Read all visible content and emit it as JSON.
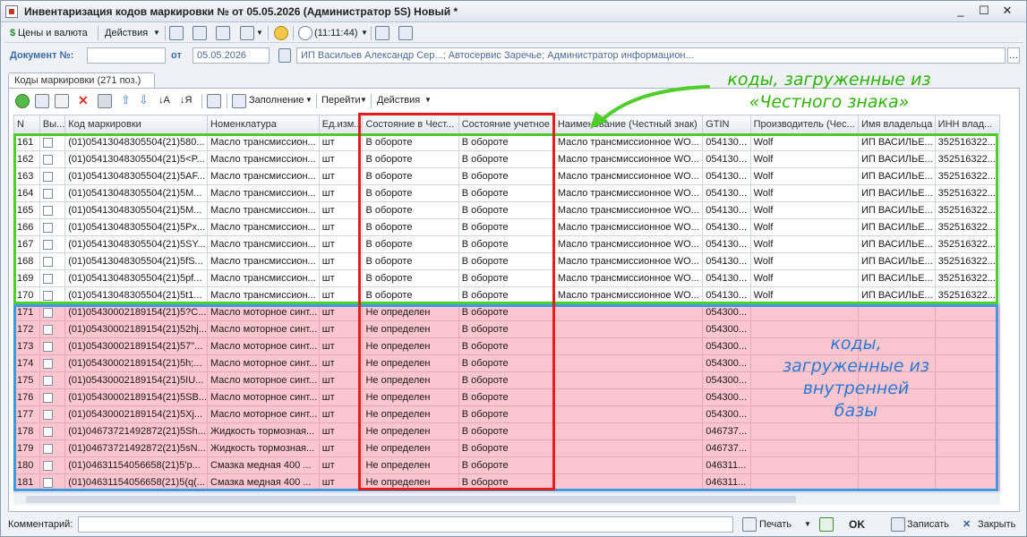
{
  "window": {
    "title": "Инвентаризация кодов маркировки №  от 05.05.2026 (Администратор 5S) Новый *",
    "controls": [
      "_",
      "☐",
      "✕"
    ]
  },
  "toolbar": {
    "prices_label": "Цены и валюта",
    "actions_label": "Действия",
    "time_label": "(11:11:44)"
  },
  "document": {
    "number_label": "Документ №:",
    "number_value": "",
    "date_label": "от",
    "date_value": "05.05.2026",
    "info_value": "ИП Васильев Александр Сер...; Автосервис Заречье; Администратор информацион..."
  },
  "tab": {
    "label": "Коды маркировки (271 поз.)"
  },
  "panel_toolbar": {
    "fill_label": "Заполнение",
    "goto_label": "Перейти",
    "actions_label": "Действия"
  },
  "table": {
    "columns": [
      "N",
      "Вы...",
      "Код маркировки",
      "Номенклатура",
      "Ед.изм...",
      "Состояние в Чест...",
      "Состояние учетное",
      "Наименование (Честный знак)",
      "GTIN",
      "Производитель (Чес...",
      "Имя владельца",
      "ИНН влад..."
    ],
    "rows": [
      {
        "n": "161",
        "code": "(01)05413048305504(21)580...",
        "nom": "Масло трансмиссион...",
        "unit": "шт",
        "state_cz": "В обороте",
        "state_acc": "В обороте",
        "name_cz": "Масло трансмиссионное WO...",
        "gtin": "054130...",
        "maker": "Wolf",
        "owner": "ИП ВАСИЛЬЕ...",
        "inn": "352516322..."
      },
      {
        "n": "162",
        "code": "(01)05413048305504(21)5<P...",
        "nom": "Масло трансмиссион...",
        "unit": "шт",
        "state_cz": "В обороте",
        "state_acc": "В обороте",
        "name_cz": "Масло трансмиссионное WO...",
        "gtin": "054130...",
        "maker": "Wolf",
        "owner": "ИП ВАСИЛЬЕ...",
        "inn": "352516322..."
      },
      {
        "n": "163",
        "code": "(01)05413048305504(21)5AF...",
        "nom": "Масло трансмиссион...",
        "unit": "шт",
        "state_cz": "В обороте",
        "state_acc": "В обороте",
        "name_cz": "Масло трансмиссионное WO...",
        "gtin": "054130...",
        "maker": "Wolf",
        "owner": "ИП ВАСИЛЬЕ...",
        "inn": "352516322..."
      },
      {
        "n": "164",
        "code": "(01)05413048305504(21)5M...",
        "nom": "Масло трансмиссион...",
        "unit": "шт",
        "state_cz": "В обороте",
        "state_acc": "В обороте",
        "name_cz": "Масло трансмиссионное WO...",
        "gtin": "054130...",
        "maker": "Wolf",
        "owner": "ИП ВАСИЛЬЕ...",
        "inn": "352516322..."
      },
      {
        "n": "165",
        "code": "(01)05413048305504(21)5M...",
        "nom": "Масло трансмиссион...",
        "unit": "шт",
        "state_cz": "В обороте",
        "state_acc": "В обороте",
        "name_cz": "Масло трансмиссионное WO...",
        "gtin": "054130...",
        "maker": "Wolf",
        "owner": "ИП ВАСИЛЬЕ...",
        "inn": "352516322..."
      },
      {
        "n": "166",
        "code": "(01)05413048305504(21)5Px...",
        "nom": "Масло трансмиссион...",
        "unit": "шт",
        "state_cz": "В обороте",
        "state_acc": "В обороте",
        "name_cz": "Масло трансмиссионное WO...",
        "gtin": "054130...",
        "maker": "Wolf",
        "owner": "ИП ВАСИЛЬЕ...",
        "inn": "352516322..."
      },
      {
        "n": "167",
        "code": "(01)05413048305504(21)5SY...",
        "nom": "Масло трансмиссион...",
        "unit": "шт",
        "state_cz": "В обороте",
        "state_acc": "В обороте",
        "name_cz": "Масло трансмиссионное WO...",
        "gtin": "054130...",
        "maker": "Wolf",
        "owner": "ИП ВАСИЛЬЕ...",
        "inn": "352516322..."
      },
      {
        "n": "168",
        "code": "(01)05413048305504(21)5fS...",
        "nom": "Масло трансмиссион...",
        "unit": "шт",
        "state_cz": "В обороте",
        "state_acc": "В обороте",
        "name_cz": "Масло трансмиссионное WO...",
        "gtin": "054130...",
        "maker": "Wolf",
        "owner": "ИП ВАСИЛЬЕ...",
        "inn": "352516322..."
      },
      {
        "n": "169",
        "code": "(01)05413048305504(21)5pf...",
        "nom": "Масло трансмиссион...",
        "unit": "шт",
        "state_cz": "В обороте",
        "state_acc": "В обороте",
        "name_cz": "Масло трансмиссионное WO...",
        "gtin": "054130...",
        "maker": "Wolf",
        "owner": "ИП ВАСИЛЬЕ...",
        "inn": "352516322..."
      },
      {
        "n": "170",
        "code": "(01)05413048305504(21)5t1...",
        "nom": "Масло трансмиссион...",
        "unit": "шт",
        "state_cz": "В обороте",
        "state_acc": "В обороте",
        "name_cz": "Масло трансмиссионное WO...",
        "gtin": "054130...",
        "maker": "Wolf",
        "owner": "ИП ВАСИЛЬЕ...",
        "inn": "352516322..."
      },
      {
        "n": "171",
        "code": "(01)05430002189154(21)5?C...",
        "nom": "Масло моторное синт...",
        "unit": "шт",
        "state_cz": "Не определен",
        "state_acc": "В обороте",
        "name_cz": "",
        "gtin": "054300...",
        "maker": "",
        "owner": "",
        "inn": ""
      },
      {
        "n": "172",
        "code": "(01)05430002189154(21)52hj...",
        "nom": "Масло моторное синт...",
        "unit": "шт",
        "state_cz": "Не определен",
        "state_acc": "В обороте",
        "name_cz": "",
        "gtin": "054300...",
        "maker": "",
        "owner": "",
        "inn": ""
      },
      {
        "n": "173",
        "code": "(01)05430002189154(21)57\"...",
        "nom": "Масло моторное синт...",
        "unit": "шт",
        "state_cz": "Не определен",
        "state_acc": "В обороте",
        "name_cz": "",
        "gtin": "054300...",
        "maker": "",
        "owner": "",
        "inn": ""
      },
      {
        "n": "174",
        "code": "(01)05430002189154(21)5h;...",
        "nom": "Масло моторное синт...",
        "unit": "шт",
        "state_cz": "Не определен",
        "state_acc": "В обороте",
        "name_cz": "",
        "gtin": "054300...",
        "maker": "",
        "owner": "",
        "inn": ""
      },
      {
        "n": "175",
        "code": "(01)05430002189154(21)5IU...",
        "nom": "Масло моторное синт...",
        "unit": "шт",
        "state_cz": "Не определен",
        "state_acc": "В обороте",
        "name_cz": "",
        "gtin": "054300...",
        "maker": "",
        "owner": "",
        "inn": ""
      },
      {
        "n": "176",
        "code": "(01)05430002189154(21)5SB...",
        "nom": "Масло моторное синт...",
        "unit": "шт",
        "state_cz": "Не определен",
        "state_acc": "В обороте",
        "name_cz": "",
        "gtin": "054300...",
        "maker": "",
        "owner": "",
        "inn": ""
      },
      {
        "n": "177",
        "code": "(01)05430002189154(21)5Xj...",
        "nom": "Масло моторное синт...",
        "unit": "шт",
        "state_cz": "Не определен",
        "state_acc": "В обороте",
        "name_cz": "",
        "gtin": "054300...",
        "maker": "",
        "owner": "",
        "inn": ""
      },
      {
        "n": "178",
        "code": "(01)04673721492872(21)5Sh...",
        "nom": "Жидкость тормозная...",
        "unit": "шт",
        "state_cz": "Не определен",
        "state_acc": "В обороте",
        "name_cz": "",
        "gtin": "046737...",
        "maker": "",
        "owner": "",
        "inn": ""
      },
      {
        "n": "179",
        "code": "(01)04673721492872(21)5sN...",
        "nom": "Жидкость тормозная...",
        "unit": "шт",
        "state_cz": "Не определен",
        "state_acc": "В обороте",
        "name_cz": "",
        "gtin": "046737...",
        "maker": "",
        "owner": "",
        "inn": ""
      },
      {
        "n": "180",
        "code": "(01)04631154056658(21)5'p...",
        "nom": "Смазка медная 400 ...",
        "unit": "шт",
        "state_cz": "Не определен",
        "state_acc": "В обороте",
        "name_cz": "",
        "gtin": "046311...",
        "maker": "",
        "owner": "",
        "inn": ""
      },
      {
        "n": "181",
        "code": "(01)04631154056658(21)5(q(...",
        "nom": "Смазка медная 400 ...",
        "unit": "шт",
        "state_cz": "Не определен",
        "state_acc": "В обороте",
        "name_cz": "",
        "gtin": "046311...",
        "maker": "",
        "owner": "",
        "inn": ""
      }
    ]
  },
  "bottom": {
    "comment_label": "Комментарий:",
    "comment_value": "",
    "print_label": "Печать",
    "ok_label": "OK",
    "save_label": "Записать",
    "close_label": "Закрыть"
  },
  "annotations": {
    "green_text": "коды, загруженные из «Честного знака»",
    "blue_text": "коды, загруженные из внутренней базы",
    "green_color": "#4fcd2a",
    "blue_color": "#3f97e5",
    "red_color": "#e11f1f"
  }
}
